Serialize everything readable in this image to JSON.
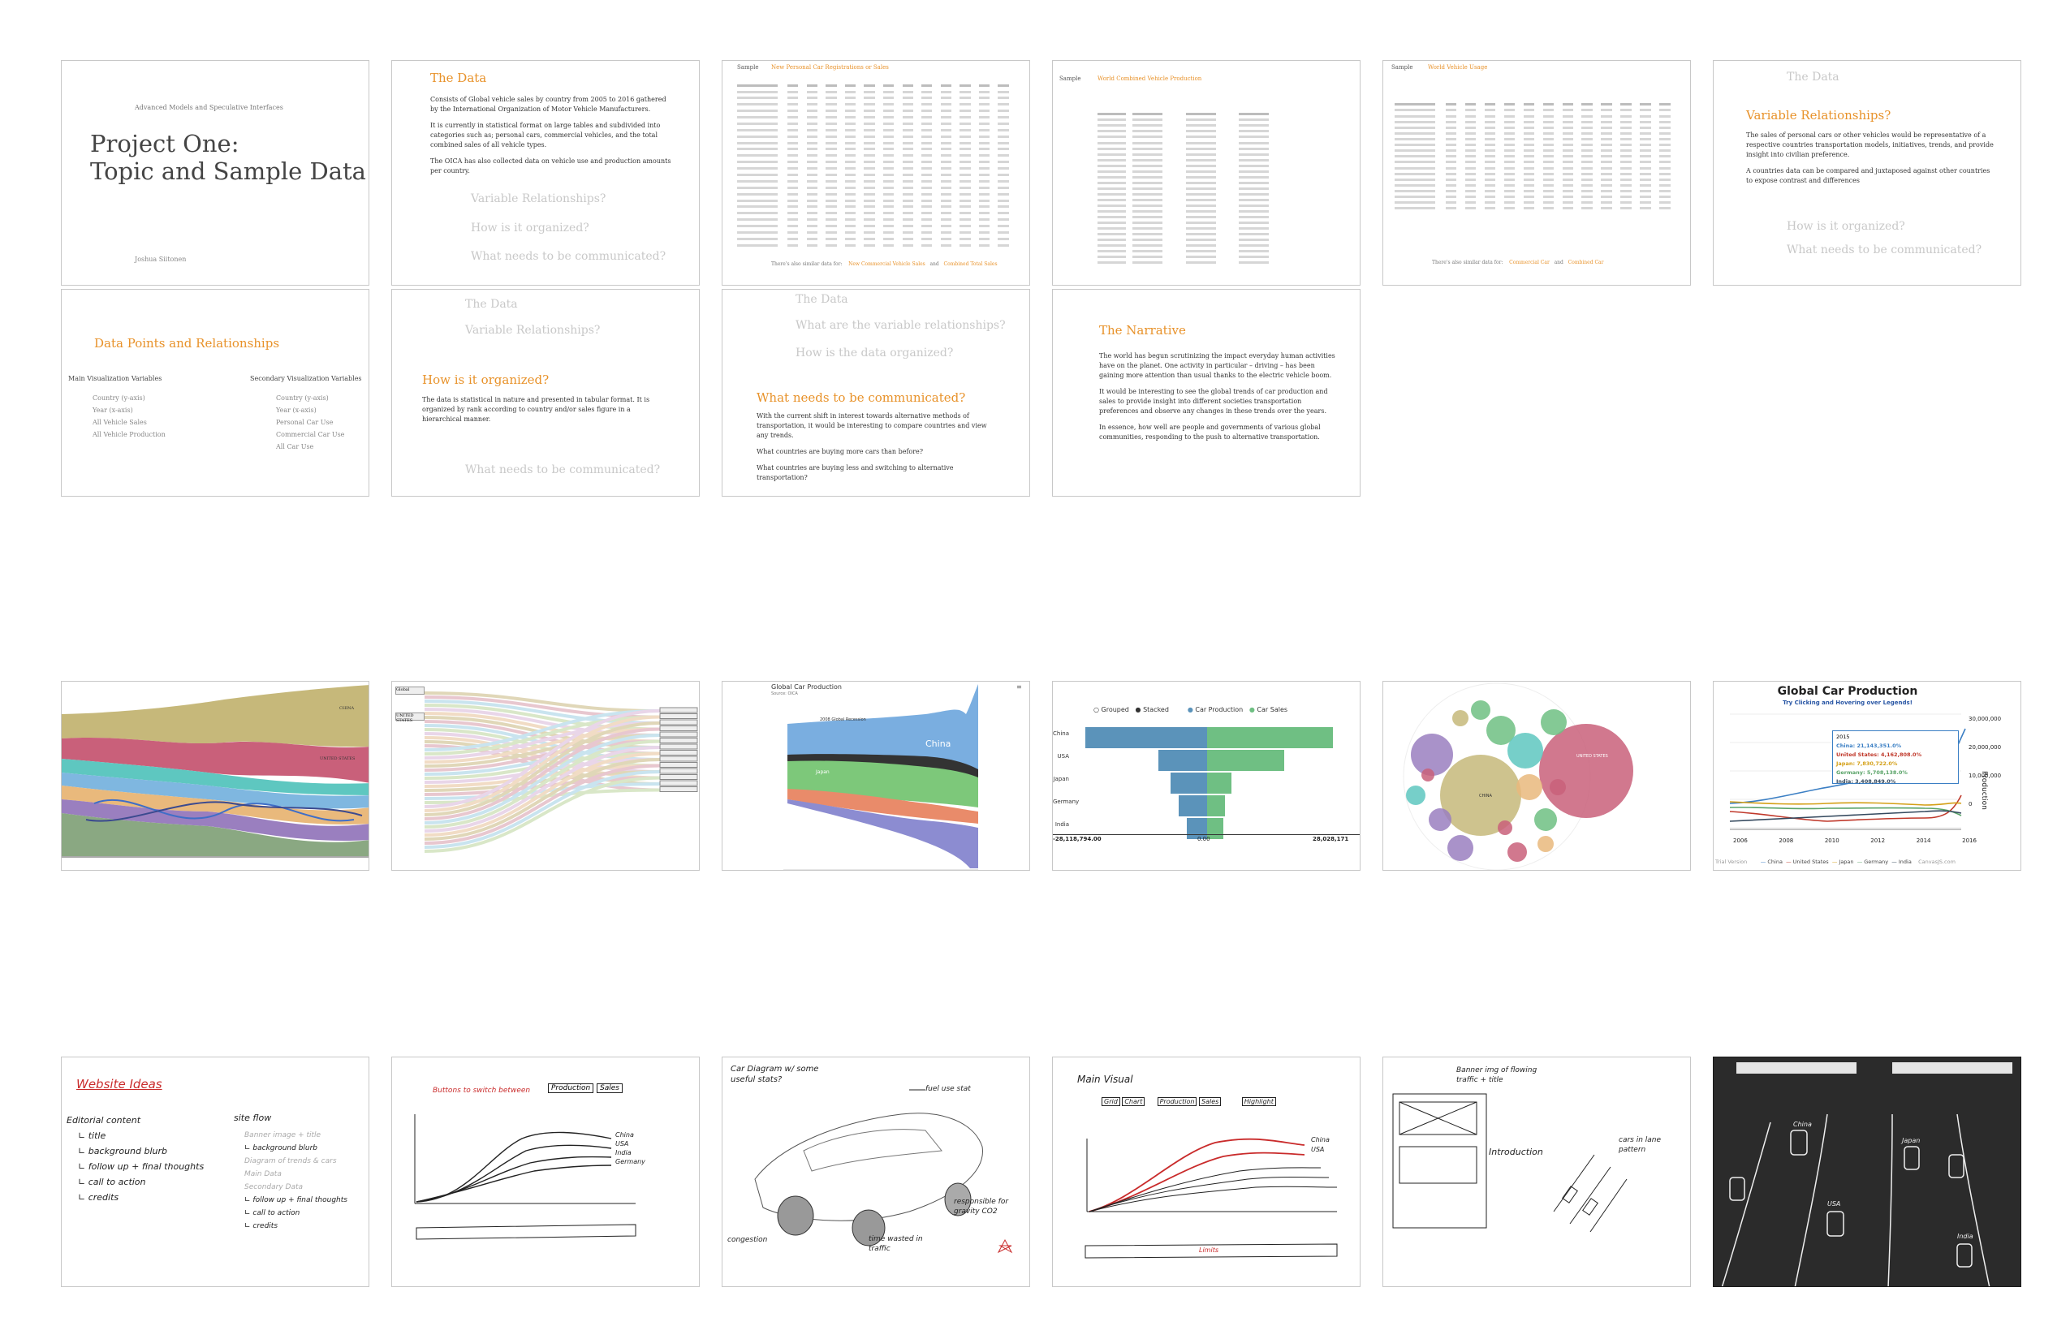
{
  "slides": {
    "s1": {
      "subtitle": "Advanced Models and Speculative Interfaces",
      "title_line1": "Project One:",
      "title_line2": "Topic and Sample Data",
      "author": "Joshua Siitonen"
    },
    "s2": {
      "heading": "The Data",
      "p1": "Consists of Global vehicle sales by country from 2005 to 2016 gathered by the International Organization of Motor Vehicle Manufacturers.",
      "p2": "It is currently in statistical format on large tables and subdivided into categories such as; personal cars, commercial vehicles, and the total combined sales of all vehicle types.",
      "p3": "The OICA has also collected data on vehicle use and production amounts per country.",
      "q1": "Variable Relationships?",
      "q2": "How is it organized?",
      "q3": "What needs to be communicated?"
    },
    "s3": {
      "label": "Sample",
      "title": "New Personal Car Registrations or Sales",
      "footer_prefix": "There's also similar data for:",
      "link1": "New Commercial Vehicle Sales",
      "and": "and",
      "link2": "Combined Total Sales"
    },
    "s4": {
      "label": "Sample",
      "title": "World Combined Vehicle Production"
    },
    "s5": {
      "label": "Sample",
      "title": "World Vehicle Usage",
      "footer_prefix": "There's also similar data for:",
      "link1": "Commercial Car",
      "and": "and",
      "link2": "Combined Car"
    },
    "s6": {
      "faded": "The Data",
      "heading": "Variable Relationships?",
      "p1": "The sales of personal cars or other vehicles would be representative of a respective countries transportation models, initiatives, trends, and provide insight into civilian preference.",
      "p2": "A countries data can be compared and juxtaposed against other countries to expose contrast and differences",
      "q2": "How is it organized?",
      "q3": "What needs to be communicated?"
    },
    "s7": {
      "heading": "Data Points and Relationships",
      "main_title": "Main Visualization Variables",
      "main_items": [
        "Country (y-axis)",
        "Year (x-axis)",
        "All Vehicle Sales",
        "All Vehicle Production"
      ],
      "sec_title": "Secondary Visualization Variables",
      "sec_items": [
        "Country (y-axis)",
        "Year (x-axis)",
        "Personal Car Use",
        "Commercial Car Use",
        "All Car Use"
      ]
    },
    "s8": {
      "faded1": "The Data",
      "faded2": "Variable Relationships?",
      "heading": "How is it organized?",
      "p1": "The data is statistical in nature and presented in tabular format. It is organized by rank according to country and/or sales figure in a hierarchical manner.",
      "q3": "What needs to be communicated?"
    },
    "s9": {
      "faded1": "The Data",
      "faded2": "What are the variable relationships?",
      "faded3": "How is the data organized?",
      "heading": "What needs to be communicated?",
      "p1": "With the current shift in interest towards alternative methods of transportation, it would be interesting to compare countries and view any trends.",
      "p2": "What countries are buying more cars than before?",
      "p3": "What countries are buying less and switching to alternative transportation?"
    },
    "s10": {
      "heading": "The Narrative",
      "p1": "The world has begun scrutinizing the impact everyday human activities have on the planet. One activity in particular – driving – has been gaining more attention than usual thanks to the electric vehicle boom.",
      "p2": "It would be interesting to see the global trends of car production and sales to provide insight into different societies transportation preferences and observe any changes in these trends over the years.",
      "p3": "In essence, how well are people and governments of various global communities, responding to the push to alternative transportation."
    }
  },
  "charts": {
    "c1": {
      "labels": [
        "CHINA",
        "UNITED STATES"
      ]
    },
    "c2": {
      "labels": [
        "Global",
        "UNITED STATES",
        "JAPAN",
        "GERMANY",
        "BRAZIL",
        "INDIA"
      ]
    },
    "c3": {
      "title": "Global Car Production",
      "subtitle": "Source: OICA",
      "l1": "China",
      "l2": "2008 Global Recession",
      "l3": "Japan"
    },
    "c4": {
      "toggle1": "Grouped",
      "toggle2": "Stacked",
      "legend1": "Car Production",
      "legend2": "Car Sales",
      "countries": [
        "China",
        "USA",
        "Japan",
        "Germany",
        "India"
      ],
      "axis_left": "-28,118,794.00",
      "axis_mid": "0.00",
      "axis_right": "28,028,171"
    },
    "c5": {
      "big": "UNITED STATES",
      "mid": "CHINA"
    },
    "c6": {
      "title": "Global Car Production",
      "subtitle": "Try Clicking and Hovering over Legends!",
      "tip_year": "2015",
      "tip_china": "China: 21,143,351.0%",
      "tip_us": "United States: 4,162,808.0%",
      "tip_japan": "Japan: 7,830,722.0%",
      "tip_germany": "Germany: 5,708,138.0%",
      "tip_india": "India: 3,408,849.0%",
      "y_ticks": [
        "30,000,000",
        "20,000,000",
        "10,000,000",
        "0"
      ],
      "y_label": "Production",
      "x_ticks": [
        "2006",
        "2008",
        "2010",
        "2012",
        "2014",
        "2016"
      ],
      "legend": [
        "China",
        "United States",
        "Japan",
        "Germany",
        "India"
      ],
      "trial": "Trial Version",
      "credit": "CanvasJS.com",
      "colors": {
        "china": "#3b7fc4",
        "us": "#c0392b",
        "japan": "#d4a017",
        "germany": "#5aa469",
        "india": "#34495e"
      }
    }
  },
  "sketches": {
    "k1": {
      "title": "Website Ideas",
      "col1": [
        "Editorial content",
        "∟ title",
        "∟ background blurb",
        "∟ follow up + final thoughts",
        "∟ call to action",
        "∟ credits"
      ],
      "col2_title": "site flow",
      "col2": [
        "Banner image + title",
        "∟ background blurb",
        "Diagram of trends & cars",
        "Main Data",
        "Secondary Data",
        "∟ follow up + final thoughts",
        "∟ call to action",
        "∟ credits"
      ]
    },
    "k2": {
      "note": "Buttons to switch between",
      "b1": "Production",
      "b2": "Sales",
      "lines": [
        "China",
        "USA",
        "India",
        "Germany"
      ]
    },
    "k3": {
      "title": "Car Diagram w/ some useful stats?",
      "n1": "fuel use stat",
      "n2": "responsible for gravity CO2",
      "n3": "congestion",
      "n4": "time wasted in traffic"
    },
    "k4": {
      "title": "Main Visual",
      "b1": "Grid",
      "b2": "Chart",
      "b3": "Production",
      "b4": "Sales",
      "b5": "Highlight",
      "lines": [
        "China",
        "USA"
      ],
      "footer": "Limits"
    },
    "k5": {
      "n1": "Banner img of flowing traffic + title",
      "n2": "Introduction",
      "n3": "cars in lane pattern"
    },
    "k6": {
      "labels": [
        "China",
        "Japan",
        "USA",
        "India"
      ]
    }
  }
}
